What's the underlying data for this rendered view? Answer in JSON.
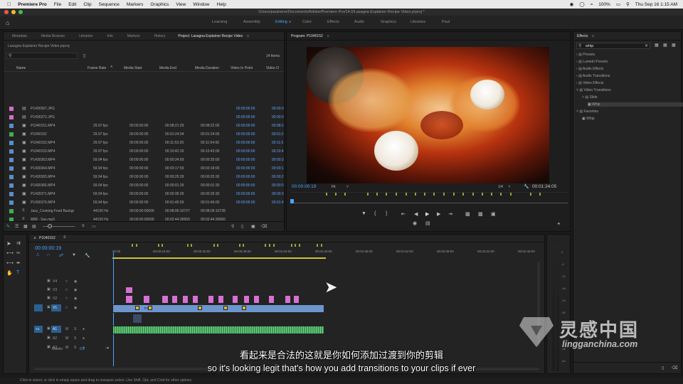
{
  "menubar": {
    "app": "Premiere Pro",
    "items": [
      "File",
      "Edit",
      "Clip",
      "Sequence",
      "Markers",
      "Graphics",
      "View",
      "Window",
      "Help"
    ],
    "battery": "100%",
    "clock": "Thu Sep 16  1:15 AM"
  },
  "titlebar": {
    "path": "/Users/paulnene/Documents/Adobe/Premiere Pro/14.0/Lasagna Explainer Recipe Video.prproj *"
  },
  "workspaces": {
    "items": [
      "Learning",
      "Assembly",
      "Editing",
      "Color",
      "Effects",
      "Audio",
      "Graphics",
      "Libraries",
      "Paul"
    ],
    "active": "Editing"
  },
  "project": {
    "tabs": [
      "Metadata",
      "Media Browser",
      "Libraries",
      "Info",
      "Markers",
      "History",
      "Project: Lasagna Explainer Recipe Video"
    ],
    "file": "Lasagna Explainer Recipe Video.prproj",
    "items_count": "14 Items",
    "columns": [
      "Name",
      "Frame Rate",
      "Media Start",
      "Media End",
      "Media Duration",
      "Video In Point",
      "Video O"
    ],
    "rows": [
      {
        "color": "#d46fc5",
        "name": "P1430367.JPG",
        "fps": "",
        "start": "",
        "end": "",
        "dur": "",
        "vin": "00:00:00:00",
        "vout": "00:00:0"
      },
      {
        "color": "#d46fc5",
        "name": "P1430372.JPG",
        "fps": "",
        "start": "",
        "end": "",
        "dur": "",
        "vin": "00:00:00:00",
        "vout": "00:00:0"
      },
      {
        "color": "#5b8ec9",
        "name": "P1040151.MP4",
        "fps": "29.97 fps",
        "start": "00:00:00:00",
        "end": "00:08:21:29",
        "dur": "00:08:22:00",
        "vin": "00:00:00:00",
        "vout": "00:08:2"
      },
      {
        "color": "#3fae4d",
        "name": "P1040152",
        "fps": "29.97 fps",
        "start": "00:00:00:00",
        "end": "00:01:24:04",
        "dur": "00:01:24:05",
        "vin": "00:00:00:00",
        "vout": "00:01:2"
      },
      {
        "color": "#5b8ec9",
        "name": "P1040152.MP4",
        "fps": "29.97 fps",
        "start": "00:00:00:00",
        "end": "00:11:53:29",
        "dur": "00:11:54:00",
        "vin": "00:00:00:00",
        "vout": "00:11:5"
      },
      {
        "color": "#5b8ec9",
        "name": "P1040153.MP4",
        "fps": "29.97 fps",
        "start": "00:00:00:00",
        "end": "00:10:42:29",
        "dur": "00:10:43:00",
        "vin": "00:00:00:00",
        "vout": "00:10:4"
      },
      {
        "color": "#5b8ec9",
        "name": "P1430363.MP4",
        "fps": "59.94 fps",
        "start": "00:00:00:00",
        "end": "00:00:34:59",
        "dur": "00:00:35:00",
        "vin": "00:00:00:00",
        "vout": "00:00:3"
      },
      {
        "color": "#5b8ec9",
        "name": "P1430364.MP4",
        "fps": "59.94 fps",
        "start": "00:00:00:00",
        "end": "00:03:17:59",
        "dur": "00:03:18:00",
        "vin": "00:00:00:00",
        "vout": "00:03:1"
      },
      {
        "color": "#5b8ec9",
        "name": "P1430365.MP4",
        "fps": "59.94 fps",
        "start": "00:00:00:00",
        "end": "00:00:25:29",
        "dur": "00:00:25:30",
        "vin": "00:00:00:00",
        "vout": "00:00:2"
      },
      {
        "color": "#5b8ec9",
        "name": "P1430366.MP4",
        "fps": "59.94 fps",
        "start": "00:00:00:00",
        "end": "00:00:01:29",
        "dur": "00:00:01:30",
        "vin": "00:00:00:00",
        "vout": "00:00:0"
      },
      {
        "color": "#5b8ec9",
        "name": "P1430371.MP4",
        "fps": "59.94 fps",
        "start": "00:00:00:00",
        "end": "00:00:35:29",
        "dur": "00:00:35:30",
        "vin": "00:00:00:00",
        "vout": "00:00:3"
      },
      {
        "color": "#5b8ec9",
        "name": "P1430376.MP4",
        "fps": "59.94 fps",
        "start": "00:00:00:00",
        "end": "00:01:45:59",
        "dur": "00:01:46:00",
        "vin": "00:00:00:00",
        "vout": "00:01:4"
      },
      {
        "color": "#3fae4d",
        "name": "Jazz_Cooking Food Backgr",
        "fps": "44100 Hz",
        "start": "00:00:00:00000",
        "end": "00:08:06:10727",
        "dur": "00:08:06:10728",
        "vin": "",
        "vout": ""
      },
      {
        "color": "#3fae4d",
        "name": "M88 - Sax.mp3",
        "fps": "44100 Hz",
        "start": "00:00:00:00000",
        "end": "00:02:44:30959",
        "dur": "00:02:44:30960",
        "vin": "",
        "vout": ""
      }
    ]
  },
  "program": {
    "tab": "Program: P1040152",
    "timecode": "00:00:00:19",
    "fit": "Fit",
    "quality": "1/4",
    "duration": "00:01:24:05"
  },
  "timeline": {
    "sequence": "P1040152",
    "timecode": "00:00:00:19",
    "ruler": [
      "00:00",
      "00:00:16:00",
      "00:00:32:00",
      "00:00:48:00",
      "00:01:04:00",
      "00:01:20:00",
      "00:01:36:00",
      "00:01:52:00",
      "00:02:08:00",
      "00:02:24:00",
      "00:02:40:00"
    ],
    "tracks": [
      "V4",
      "V3",
      "V2",
      "V1",
      "A1",
      "A2",
      "A3"
    ],
    "master": "Master",
    "master_val": "0.0",
    "clip_label": "P104"
  },
  "effects": {
    "title": "Effects",
    "search": "whip",
    "tree": [
      {
        "label": "Presets",
        "indent": 0
      },
      {
        "label": "Lumetri Presets",
        "indent": 0
      },
      {
        "label": "Audio Effects",
        "indent": 0
      },
      {
        "label": "Audio Transitions",
        "indent": 0
      },
      {
        "label": "Video Effects",
        "indent": 0
      },
      {
        "label": "Video Transitions",
        "indent": 0
      },
      {
        "label": "Slide",
        "indent": 1
      },
      {
        "label": "Whip",
        "indent": 2
      },
      {
        "label": "Favorites",
        "indent": 0
      },
      {
        "label": "Whip",
        "indent": 1
      }
    ]
  },
  "meter_scale": [
    "0",
    "-6",
    "-12",
    "-18",
    "-24",
    "-30",
    "-36",
    "-42",
    "-48",
    "-54"
  ],
  "statusbar": "Click to select, or click in empty space and drag to marquee select. Use Shift, Opt, and Cmd for other options.",
  "subtitles": {
    "zh": "看起来是合法的这就是你如何添加过渡到你的剪辑",
    "en": "so it's looking legit that's how you add transitions to your clips if ever"
  },
  "watermark": {
    "cn": "灵感中国",
    "url": "lingganchina.com"
  }
}
